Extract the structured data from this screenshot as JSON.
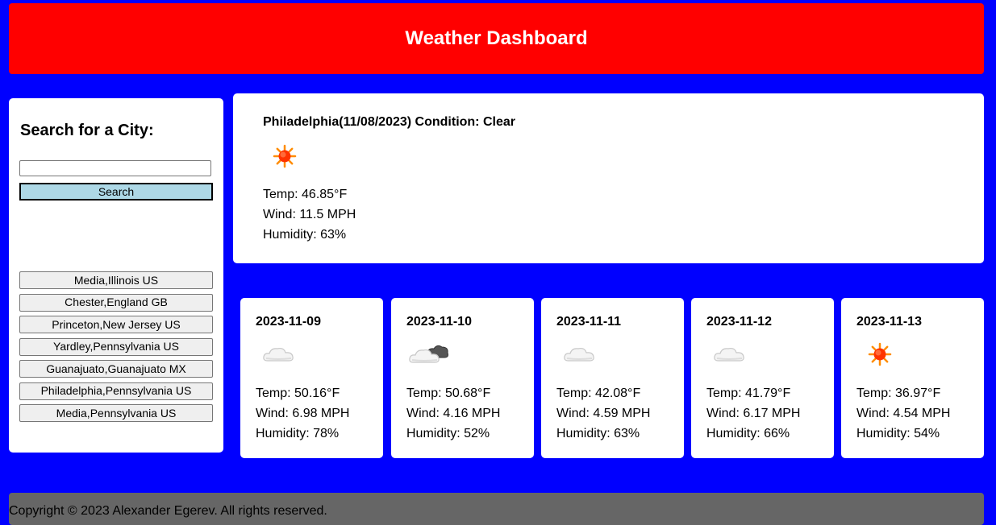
{
  "header": {
    "title": "Weather Dashboard"
  },
  "sidebar": {
    "heading": "Search for a City:",
    "search_value": "",
    "search_button": "Search",
    "history": [
      "Media,Illinois US",
      "Chester,England GB",
      "Princeton,New Jersey US",
      "Yardley,Pennsylvania US",
      "Guanajuato,Guanajuato MX",
      "Philadelphia,Pennsylvania US",
      "Media,Pennsylvania US"
    ]
  },
  "current": {
    "title": "Philadelphia(11/08/2023) Condition: Clear",
    "icon": "sun-icon",
    "temp": "Temp: 46.85°F",
    "wind": "Wind: 11.5 MPH",
    "humidity": "Humidity: 63%"
  },
  "forecast": [
    {
      "date": "2023-11-09",
      "icon": "cloud-icon",
      "temp": "Temp: 50.16°F",
      "wind": "Wind: 6.98 MPH",
      "humidity": "Humidity: 78%"
    },
    {
      "date": "2023-11-10",
      "icon": "broken-clouds-icon",
      "temp": "Temp: 50.68°F",
      "wind": "Wind: 4.16 MPH",
      "humidity": "Humidity: 52%"
    },
    {
      "date": "2023-11-11",
      "icon": "cloud-icon",
      "temp": "Temp: 42.08°F",
      "wind": "Wind: 4.59 MPH",
      "humidity": "Humidity: 63%"
    },
    {
      "date": "2023-11-12",
      "icon": "cloud-icon",
      "temp": "Temp: 41.79°F",
      "wind": "Wind: 6.17 MPH",
      "humidity": "Humidity: 66%"
    },
    {
      "date": "2023-11-13",
      "icon": "sun-icon",
      "temp": "Temp: 36.97°F",
      "wind": "Wind: 4.54 MPH",
      "humidity": "Humidity: 54%"
    }
  ],
  "footer": {
    "text": "Copyright © 2023 Alexander Egerev. All rights reserved."
  },
  "colors": {
    "header": "#ff0000",
    "background": "#0000ff",
    "search_button": "#add8e6",
    "footer": "#666666"
  }
}
